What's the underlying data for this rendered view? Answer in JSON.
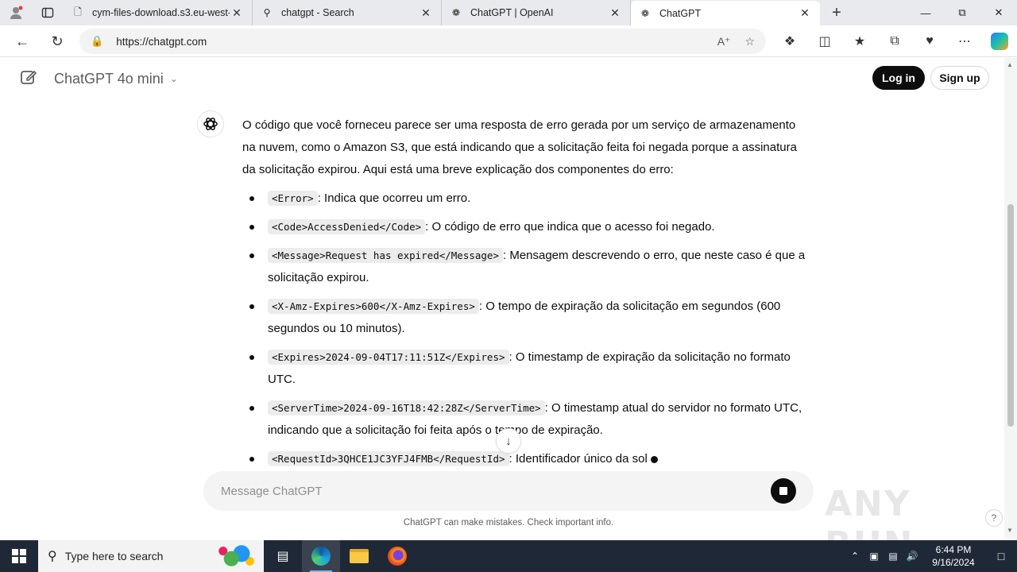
{
  "browser": {
    "tabs": [
      {
        "title": "cym-files-download.s3.eu-west-",
        "icon": "document-icon"
      },
      {
        "title": "chatgpt - Search",
        "icon": "search-icon"
      },
      {
        "title": "ChatGPT | OpenAI",
        "icon": "openai-icon"
      },
      {
        "title": "ChatGPT",
        "icon": "openai-icon",
        "active": true
      }
    ],
    "url": "https://chatgpt.com"
  },
  "chat": {
    "model_label": "ChatGPT 4o mini",
    "login_label": "Log in",
    "signup_label": "Sign up",
    "intro": "O código que você forneceu parece ser uma resposta de erro gerada por um serviço de armazenamento na nuvem, como o Amazon S3, que está indicando que a solicitação feita foi negada porque a assinatura da solicitação expirou. Aqui está uma breve explicação dos componentes do erro:",
    "items": [
      {
        "code": "<Error>",
        "text": ": Indica que ocorreu um erro."
      },
      {
        "code": "<Code>AccessDenied</Code>",
        "text": ": O código de erro que indica que o acesso foi negado."
      },
      {
        "code": "<Message>Request has expired</Message>",
        "text": ": Mensagem descrevendo o erro, que neste caso é que a solicitação expirou."
      },
      {
        "code": "<X-Amz-Expires>600</X-Amz-Expires>",
        "text": ": O tempo de expiração da solicitação em segundos (600 segundos ou 10 minutos)."
      },
      {
        "code": "<Expires>2024-09-04T17:11:51Z</Expires>",
        "text": ": O timestamp de expiração da solicitação no formato UTC."
      },
      {
        "code": "<ServerTime>2024-09-16T18:42:28Z</ServerTime>",
        "text": ": O timestamp atual do servidor no formato UTC, indicando que a solicitação foi feita após o tempo de expiração."
      },
      {
        "code": "<RequestId>3QHCE1JC3YFJ4FMB</RequestId>",
        "text": ": Identificador único da sol"
      }
    ],
    "composer_placeholder": "Message ChatGPT",
    "disclaimer": "ChatGPT can make mistakes. Check important info.",
    "help_label": "?"
  },
  "watermark": "ANY RUN",
  "taskbar": {
    "search_placeholder": "Type here to search",
    "time": "6:44 PM",
    "date": "9/16/2024"
  }
}
